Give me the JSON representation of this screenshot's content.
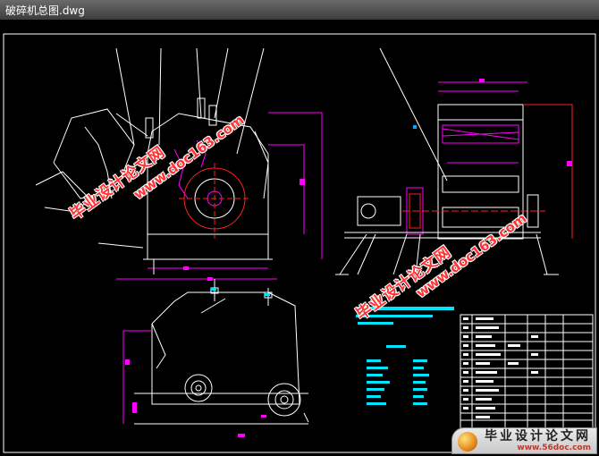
{
  "window": {
    "title": "破碎机总图.dwg"
  },
  "watermarks": {
    "cn_text": "毕业设计论文网",
    "url_text": "www.doc163.com"
  },
  "logo": {
    "title": "毕业设计论文网",
    "url": "www.56doc.com"
  },
  "colors": {
    "outline": "#ffffff",
    "dimension": "#ff00ff",
    "center_line": "#ff2020",
    "leader": "#ffffff",
    "text_block": "#00e5ff"
  }
}
